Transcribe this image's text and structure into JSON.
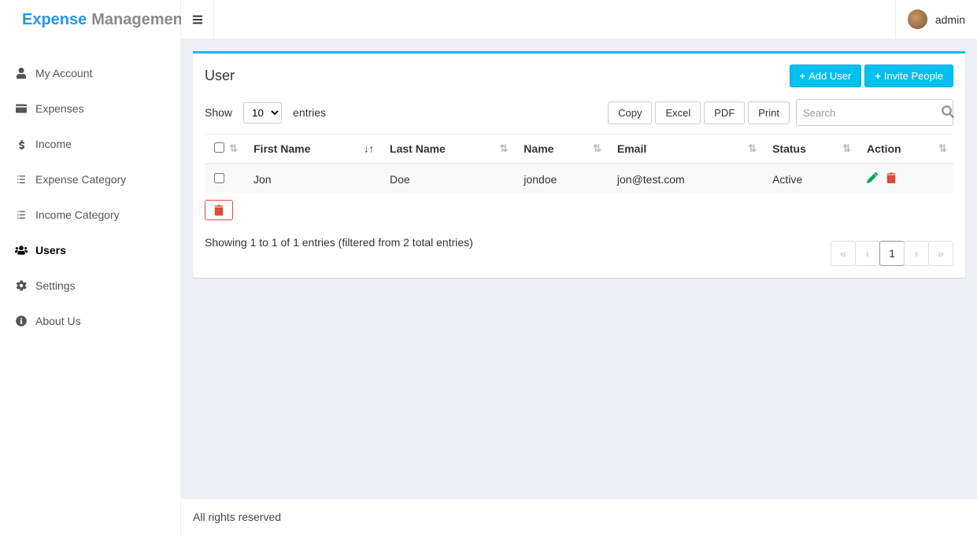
{
  "brand": {
    "word1": "Expense",
    "word2": "Management"
  },
  "sidebar": {
    "items": [
      {
        "icon": "user-icon",
        "label": "My Account"
      },
      {
        "icon": "credit-card-icon",
        "label": "Expenses"
      },
      {
        "icon": "dollar-icon",
        "label": "Income"
      },
      {
        "icon": "list-icon",
        "label": "Expense Category"
      },
      {
        "icon": "list-icon",
        "label": "Income Category"
      },
      {
        "icon": "users-icon",
        "label": "Users",
        "active": true
      },
      {
        "icon": "cogs-icon",
        "label": "Settings"
      },
      {
        "icon": "info-icon",
        "label": "About Us"
      }
    ]
  },
  "topbar": {
    "username": "admin"
  },
  "page": {
    "title": "User",
    "add_user": "Add User",
    "invite_people": "Invite People"
  },
  "datatable": {
    "show": "Show",
    "entries": "entries",
    "length_value": "10",
    "buttons": {
      "copy": "Copy",
      "excel": "Excel",
      "pdf": "PDF",
      "print": "Print"
    },
    "search_placeholder": "Search",
    "columns": [
      "",
      "First Name",
      "Last Name",
      "Name",
      "Email",
      "Status",
      "Action"
    ],
    "rows": [
      {
        "first_name": "Jon",
        "last_name": "Doe",
        "name": "jondoe",
        "email": "jon@test.com",
        "status": "Active"
      }
    ],
    "info": "Showing 1 to 1 of 1 entries (filtered from 2 total entries)",
    "page_current": "1"
  },
  "footer": {
    "text": "All rights reserved"
  }
}
